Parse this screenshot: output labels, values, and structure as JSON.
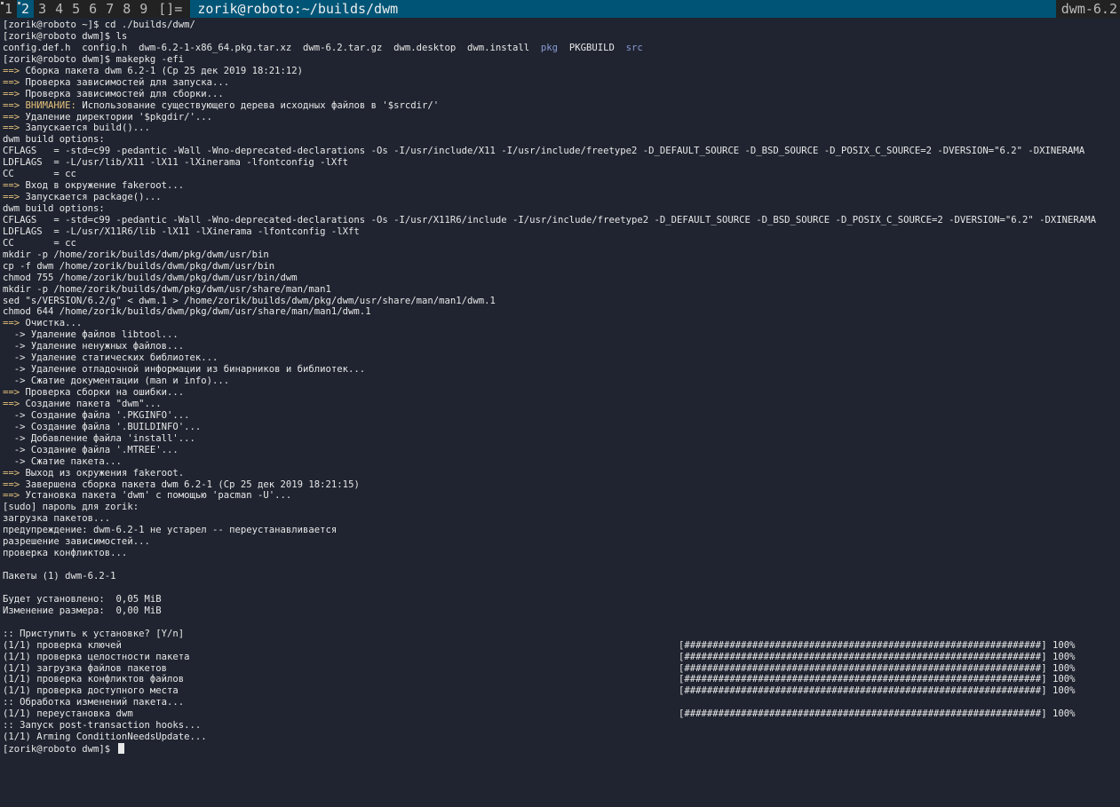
{
  "bar": {
    "tags": [
      "1",
      "2",
      "3",
      "4",
      "5",
      "6",
      "7",
      "8",
      "9"
    ],
    "selected_tag_index": 1,
    "occupied_tag_indices": [
      0,
      1
    ],
    "layout": "[]=",
    "title": "zorik@roboto:~/builds/dwm",
    "status": "dwm-6.2"
  },
  "terminal": {
    "lines": [
      {
        "t": "[zorik@roboto ~]$ cd ./builds/dwm/"
      },
      {
        "t": "[zorik@roboto dwm]$ ls"
      },
      {
        "segments": [
          {
            "t": "config.def.h  config.h  dwm-6.2-1-x86_64.pkg.tar.xz  dwm-6.2.tar.gz  dwm.desktop  dwm.install  "
          },
          {
            "t": "pkg",
            "c": "blue"
          },
          {
            "t": "  PKGBUILD  "
          },
          {
            "t": "src",
            "c": "blue"
          }
        ]
      },
      {
        "t": "[zorik@roboto dwm]$ makepkg -efi"
      },
      {
        "a": "==>",
        "t": " Сборка пакета dwm 6.2-1 (Ср 25 дек 2019 18:21:12)"
      },
      {
        "a": "==>",
        "t": " Проверка зависимостей для запуска..."
      },
      {
        "a": "==>",
        "t": " Проверка зависимостей для сборки..."
      },
      {
        "a": "==>",
        "segments": [
          {
            "t": " "
          },
          {
            "t": "ВНИМАНИЕ:",
            "c": "warn"
          },
          {
            "t": " Использование существующего дерева исходных файлов в '$srcdir/'"
          }
        ]
      },
      {
        "a": "==>",
        "t": " Удаление директории '$pkgdir/'..."
      },
      {
        "a": "==>",
        "t": " Запускается build()..."
      },
      {
        "t": "dwm build options:"
      },
      {
        "t": "CFLAGS   = -std=c99 -pedantic -Wall -Wno-deprecated-declarations -Os -I/usr/include/X11 -I/usr/include/freetype2 -D_DEFAULT_SOURCE -D_BSD_SOURCE -D_POSIX_C_SOURCE=2 -DVERSION=\"6.2\" -DXINERAMA"
      },
      {
        "t": "LDFLAGS  = -L/usr/lib/X11 -lX11 -lXinerama -lfontconfig -lXft"
      },
      {
        "t": "CC       = cc"
      },
      {
        "a": "==>",
        "t": " Вход в окружение fakeroot..."
      },
      {
        "a": "==>",
        "t": " Запускается package()..."
      },
      {
        "t": "dwm build options:"
      },
      {
        "t": "CFLAGS   = -std=c99 -pedantic -Wall -Wno-deprecated-declarations -Os -I/usr/X11R6/include -I/usr/include/freetype2 -D_DEFAULT_SOURCE -D_BSD_SOURCE -D_POSIX_C_SOURCE=2 -DVERSION=\"6.2\" -DXINERAMA"
      },
      {
        "t": "LDFLAGS  = -L/usr/X11R6/lib -lX11 -lXinerama -lfontconfig -lXft"
      },
      {
        "t": "CC       = cc"
      },
      {
        "t": "mkdir -p /home/zorik/builds/dwm/pkg/dwm/usr/bin"
      },
      {
        "t": "cp -f dwm /home/zorik/builds/dwm/pkg/dwm/usr/bin"
      },
      {
        "t": "chmod 755 /home/zorik/builds/dwm/pkg/dwm/usr/bin/dwm"
      },
      {
        "t": "mkdir -p /home/zorik/builds/dwm/pkg/dwm/usr/share/man/man1"
      },
      {
        "t": "sed \"s/VERSION/6.2/g\" < dwm.1 > /home/zorik/builds/dwm/pkg/dwm/usr/share/man/man1/dwm.1"
      },
      {
        "t": "chmod 644 /home/zorik/builds/dwm/pkg/dwm/usr/share/man/man1/dwm.1"
      },
      {
        "a": "==>",
        "t": " Очистка..."
      },
      {
        "t": "  -> Удаление файлов libtool..."
      },
      {
        "t": "  -> Удаление ненужных файлов..."
      },
      {
        "t": "  -> Удаление статических библиотек..."
      },
      {
        "t": "  -> Удаление отладочной информации из бинарников и библиотек..."
      },
      {
        "t": "  -> Сжатие документации (man и info)..."
      },
      {
        "a": "==>",
        "t": " Проверка сборки на ошибки..."
      },
      {
        "a": "==>",
        "t": " Создание пакета \"dwm\"..."
      },
      {
        "t": "  -> Создание файла '.PKGINFO'..."
      },
      {
        "t": "  -> Создание файла '.BUILDINFO'..."
      },
      {
        "t": "  -> Добавление файла 'install'..."
      },
      {
        "t": "  -> Создание файла '.MTREE'..."
      },
      {
        "t": "  -> Сжатие пакета..."
      },
      {
        "a": "==>",
        "t": " Выход из окружения fakeroot."
      },
      {
        "a": "==>",
        "t": " Завершена сборка пакета dwm 6.2-1 (Ср 25 дек 2019 18:21:15)"
      },
      {
        "a": "==>",
        "t": " Установка пакета 'dwm' с помощью 'pacman -U'..."
      },
      {
        "t": "[sudo] пароль для zorik:"
      },
      {
        "t": "загрузка пакетов..."
      },
      {
        "t": "предупреждение: dwm-6.2-1 не устарел -- переустанавливается"
      },
      {
        "t": "разрешение зависимостей..."
      },
      {
        "t": "проверка конфликтов..."
      },
      {
        "t": ""
      },
      {
        "t": "Пакеты (1) dwm-6.2-1"
      },
      {
        "t": ""
      },
      {
        "t": "Будет установлено:  0,05 MiB"
      },
      {
        "t": "Изменение размера:  0,00 MiB"
      },
      {
        "t": ""
      },
      {
        "t": ":: Приступить к установке? [Y/n]"
      },
      {
        "t": "(1/1) проверка ключей",
        "p": "[###############################################################] 100%"
      },
      {
        "t": "(1/1) проверка целостности пакета",
        "p": "[###############################################################] 100%"
      },
      {
        "t": "(1/1) загрузка файлов пакетов",
        "p": "[###############################################################] 100%"
      },
      {
        "t": "(1/1) проверка конфликтов файлов",
        "p": "[###############################################################] 100%"
      },
      {
        "t": "(1/1) проверка доступного места",
        "p": "[###############################################################] 100%"
      },
      {
        "t": ":: Обработка изменений пакета..."
      },
      {
        "t": "(1/1) переустановка dwm",
        "p": "[###############################################################] 100%"
      },
      {
        "t": ":: Запуск post-transaction hooks..."
      },
      {
        "t": "(1/1) Arming ConditionNeedsUpdate..."
      },
      {
        "t": "[zorik@roboto dwm]$ ",
        "cursor": true
      }
    ]
  }
}
